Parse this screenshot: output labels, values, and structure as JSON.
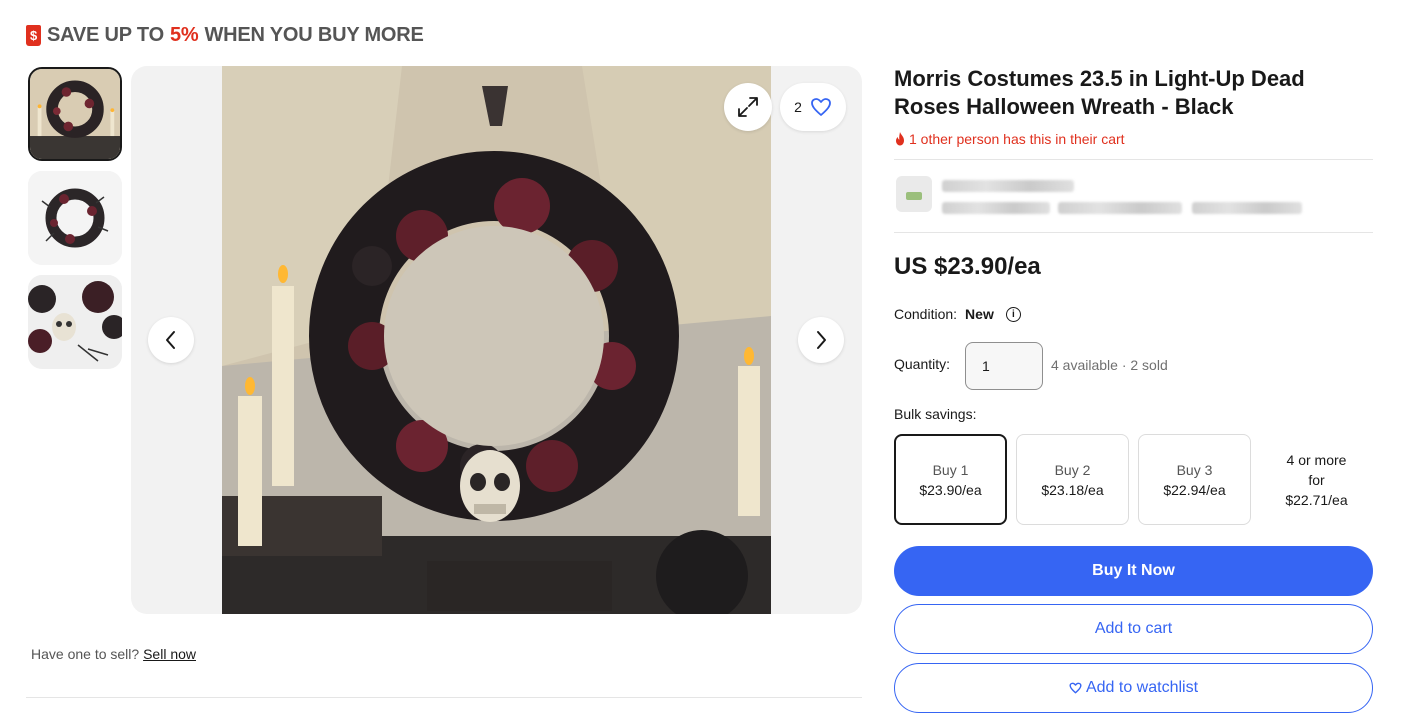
{
  "promo": {
    "prefix": "SAVE UP TO",
    "percent": "5%",
    "suffix": "WHEN YOU BUY MORE",
    "icon": "price-tag-icon",
    "icon_glyph": "$"
  },
  "gallery": {
    "thumbnails": [
      "thumbnail-1",
      "thumbnail-2",
      "thumbnail-3"
    ],
    "watch_count": "2"
  },
  "sell": {
    "text": "Have one to sell?",
    "link": "Sell now"
  },
  "listing": {
    "title": "Morris Costumes 23.5 in Light-Up Dead Roses Halloween Wreath - Black",
    "cart_note": "1 other person has this in their cart",
    "price": "US $23.90/ea",
    "condition_label": "Condition:",
    "condition_value": "New",
    "quantity_label": "Quantity:",
    "quantity_value": "1",
    "availability": "4 available · 2 sold",
    "bulk_label": "Bulk savings:"
  },
  "bulk_options": [
    {
      "qty": "Buy 1",
      "price": "$23.90/ea"
    },
    {
      "qty": "Buy 2",
      "price": "$23.18/ea"
    },
    {
      "qty": "Buy 3",
      "price": "$22.94/ea"
    },
    {
      "qty": "4 or more",
      "mid": "for",
      "price": "$22.71/ea"
    }
  ],
  "actions": {
    "buy_now": "Buy It Now",
    "add_to_cart": "Add to cart",
    "add_to_watchlist": "Add to watchlist"
  },
  "colors": {
    "accent": "#3665f3",
    "alert": "#e0301e"
  }
}
